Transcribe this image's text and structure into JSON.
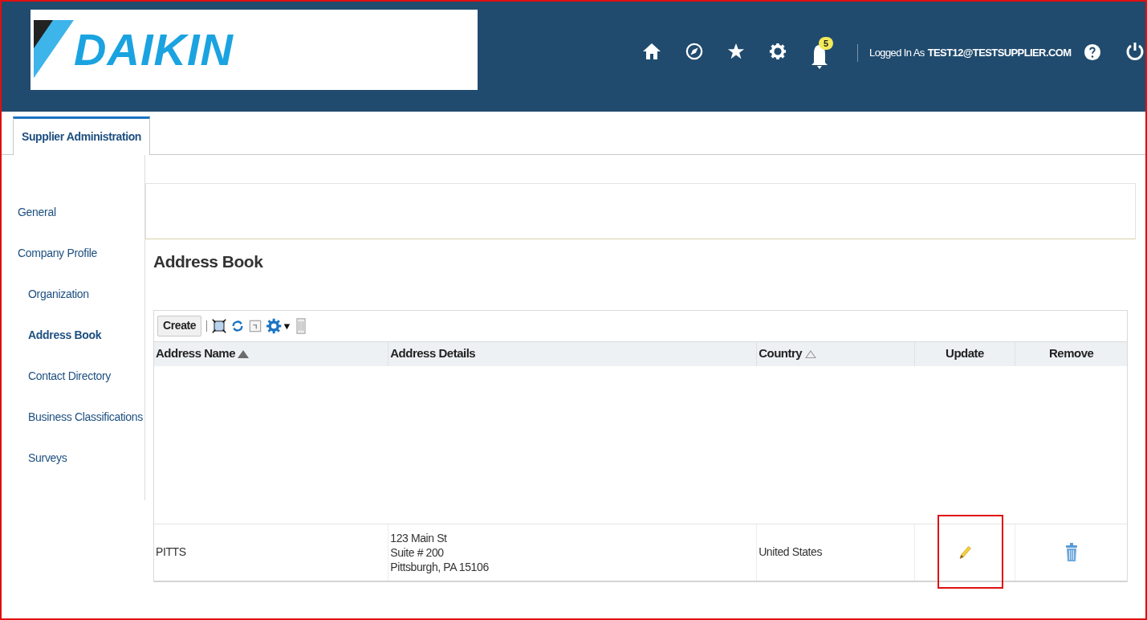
{
  "header": {
    "logo": "DAIKIN",
    "notifications": "5",
    "logged_in_label": "Logged In As",
    "user": "TEST12@TESTSUPPLIER.COM"
  },
  "tabs": [
    {
      "label": "Supplier Administration",
      "selected": true
    }
  ],
  "sidebar": {
    "items": [
      {
        "label": "General",
        "selected": false
      },
      {
        "label": "Company Profile",
        "selected": false,
        "children": [
          {
            "label": "Organization",
            "selected": false
          },
          {
            "label": "Address Book",
            "selected": true
          },
          {
            "label": "Contact Directory",
            "selected": false
          },
          {
            "label": "Business Classifications",
            "selected": false
          },
          {
            "label": "Surveys",
            "selected": false
          }
        ]
      }
    ]
  },
  "page_title": "Address Book",
  "toolbar": {
    "create": "Create"
  },
  "table": {
    "columns": [
      {
        "label": "Address Name",
        "kind": "sorted"
      },
      {
        "label": "Address Details",
        "kind": "plain"
      },
      {
        "label": "Country",
        "kind": "sortable"
      },
      {
        "label": "Update",
        "kind": "action"
      },
      {
        "label": "Remove",
        "kind": "action"
      }
    ],
    "rows": [
      {
        "name": "PITTS",
        "details": [
          "123 Main St",
          "Suite # 200",
          "Pittsburgh, PA 15106"
        ],
        "country": "United States"
      }
    ]
  }
}
